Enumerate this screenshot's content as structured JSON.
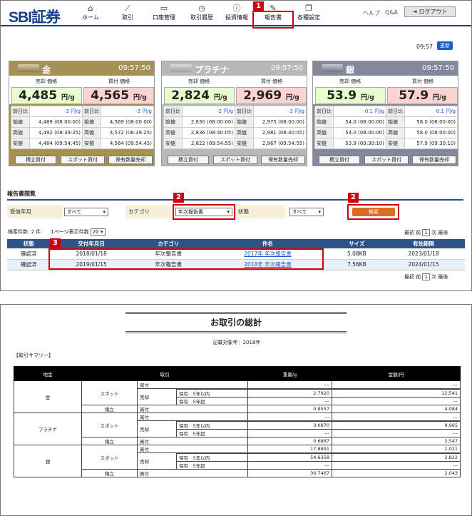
{
  "header": {
    "logo": "SBI証券",
    "nav": [
      {
        "label": "ホーム",
        "icon": "home-icon",
        "glyph": "⌂"
      },
      {
        "label": "取引",
        "icon": "chart-icon",
        "glyph": "⟋"
      },
      {
        "label": "口座管理",
        "icon": "monitor-icon",
        "glyph": "▭"
      },
      {
        "label": "取引履歴",
        "icon": "history-icon",
        "glyph": "◷"
      },
      {
        "label": "投資情報",
        "icon": "info-icon",
        "glyph": "ⓘ"
      },
      {
        "label": "報告書",
        "icon": "report-icon",
        "glyph": "✎"
      },
      {
        "label": "各種設定",
        "icon": "settings-icon",
        "glyph": "❐"
      }
    ],
    "help": "ヘルプ",
    "qa": "Q&A",
    "logout": "ログアウト",
    "logout_icon": "⇥"
  },
  "annotations": {
    "n1": "1",
    "n2a": "2",
    "n2b": "2",
    "n3": "3"
  },
  "update": {
    "time": "09:57",
    "button": "更新"
  },
  "cards": [
    {
      "name": "金",
      "time": "09:57:50",
      "color": "#a59155",
      "sell_label": "売却 価格",
      "buy_label": "買付 価格",
      "sell_price": "4,485",
      "buy_price": "4,565",
      "unit": "円/g",
      "rows": [
        [
          "前日比",
          "-3 円/g",
          "前日比",
          "-3 円/g"
        ],
        [
          "始値",
          "4,489 (08:00:00)",
          "始値",
          "4,569 (08:00:00)"
        ],
        [
          "高値",
          "4,492 (08:39:25)",
          "高値",
          "4,572 (08:39:25)"
        ],
        [
          "安値",
          "4,484 (09:54:45)",
          "安値",
          "4,564 (09:54:45)"
        ]
      ],
      "btns": [
        "積立買付",
        "スポット買付",
        "保有数量売却"
      ]
    },
    {
      "name": "プラチナ",
      "time": "09:57:50",
      "color": "#b8b8b8",
      "sell_label": "売却 価格",
      "buy_label": "買付 価格",
      "sell_price": "2,824",
      "buy_price": "2,969",
      "unit": "円/g",
      "rows": [
        [
          "前日比",
          "-2 円/g",
          "前日比",
          "-2 円/g"
        ],
        [
          "始値",
          "2,830 (08:00:00)",
          "始値",
          "2,975 (08:00:00)"
        ],
        [
          "高値",
          "2,836 (08:40:05)",
          "高値",
          "2,981 (08:40:05)"
        ],
        [
          "安値",
          "2,822 (09:54:55)",
          "安値",
          "2,967 (09:54:55)"
        ]
      ],
      "btns": [
        "積立買付",
        "スポット買付",
        "保有数量売却"
      ]
    },
    {
      "name": "銀",
      "time": "09:57:50",
      "color": "#85889a",
      "sell_label": "売却 価格",
      "buy_label": "買付 価格",
      "sell_price": "53.9",
      "buy_price": "57.9",
      "unit": "円/g",
      "rows": [
        [
          "前日比",
          "-0.1 円/g",
          "前日比",
          "-0.1 円/g"
        ],
        [
          "始値",
          "54.0 (08:00:00)",
          "始値",
          "58.0 (08:00:00)"
        ],
        [
          "高値",
          "54.0 (08:00:00)",
          "高値",
          "58.0 (08:00:00)"
        ],
        [
          "安値",
          "53.9 (09:30:10)",
          "安値",
          "57.9 (09:30:10)"
        ]
      ],
      "btns": [
        "積立買付",
        "スポット買付",
        "保有数量売却"
      ]
    }
  ],
  "reports": {
    "section_title": "報告書閲覧",
    "year_label": "受信年月",
    "year_value": "すべて",
    "category_label": "カテゴリ",
    "category_value": "年次報告書",
    "status_label": "状態",
    "status_value": "すべて",
    "search_button": "検索",
    "count_text": "検索件数: 2 件",
    "per_page_label": "1ページ表示件数",
    "per_page_value": "20",
    "pager": {
      "first": "最初",
      "prev": "前",
      "page": "1",
      "next": "次",
      "last": "最後"
    },
    "columns": [
      "状態",
      "交付年月日",
      "カテゴリ",
      "件名",
      "サイズ",
      "有効期限"
    ],
    "rows": [
      [
        "確認済",
        "2018/01/18",
        "年次報告書",
        "2017年 年次報告書",
        "5.08KB",
        "2023/01/18"
      ],
      [
        "確認済",
        "2019/01/15",
        "年次報告書",
        "2018年 年次報告書",
        "7.56KB",
        "2024/01/15"
      ]
    ]
  },
  "doc": {
    "title": "お取引の総計",
    "subtitle": "記載対象年：2018年",
    "summary_label": "【取引サマリー】",
    "headers": [
      "地金",
      "取引",
      "重量/g",
      "金額/円"
    ],
    "labels": {
      "spot": "スポット",
      "accum": "積立",
      "buy": "買付",
      "sell": "売却",
      "hold_in": "保有　5年以内",
      "hold_over": "保有　5年超"
    },
    "metals": [
      {
        "name": "金",
        "spot_buy_w": "---",
        "spot_buy_a": "---",
        "in_w": "2.7920",
        "in_a": "12,541",
        "over_w": "---",
        "over_a": "---",
        "acc_w": "0.8557",
        "acc_a": "4,084"
      },
      {
        "name": "プラチナ",
        "spot_buy_w": "---",
        "spot_buy_a": "---",
        "in_w": "3.0870",
        "in_a": "9,965",
        "over_w": "---",
        "over_a": "---",
        "acc_w": "0.6887",
        "acc_a": "2,547"
      },
      {
        "name": "銀",
        "spot_buy_w": "17.8891",
        "spot_buy_a": "1,021",
        "in_w": "54.6358",
        "in_a": "2,822",
        "over_w": "---",
        "over_a": "---",
        "acc_w": "36.7467",
        "acc_a": "2,043"
      }
    ]
  }
}
